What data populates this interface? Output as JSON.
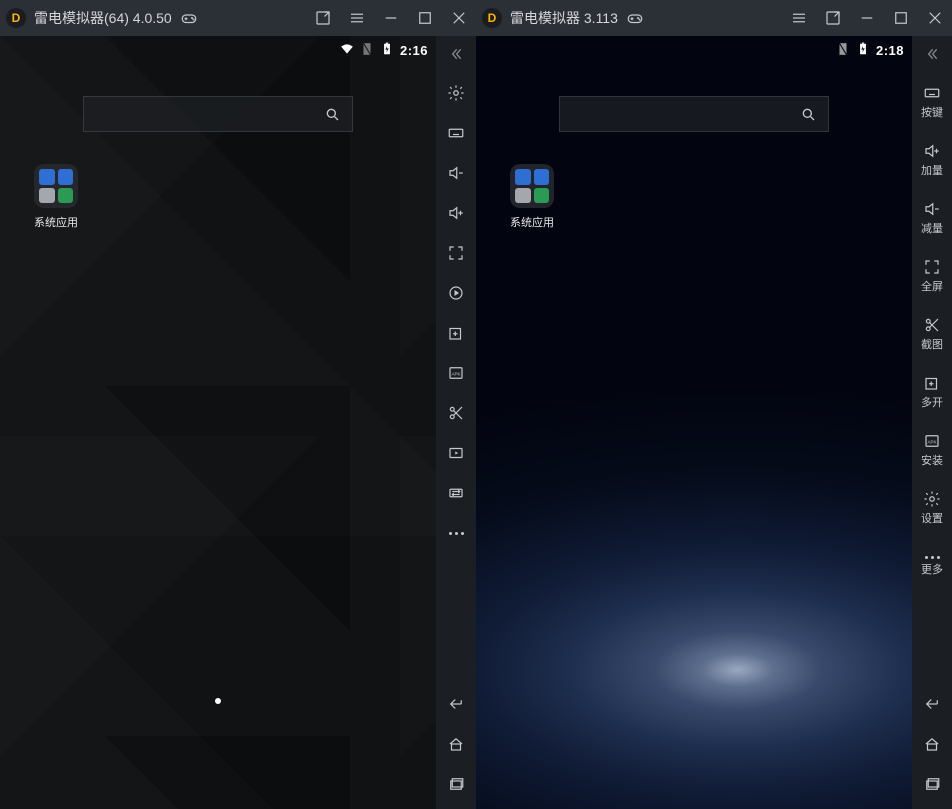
{
  "left": {
    "title": "雷电模拟器(64) 4.0.50",
    "statusbar": {
      "time": "2:16"
    },
    "folder_label": "系统应用"
  },
  "right": {
    "title": "雷电模拟器 3.113",
    "statusbar": {
      "time": "2:18"
    },
    "folder_label": "系统应用",
    "sidebar_labels": {
      "keymap": "按键",
      "vol_up": "加量",
      "vol_down": "减量",
      "fullscreen": "全屏",
      "screenshot": "截图",
      "multi": "多开",
      "install": "安装",
      "settings": "设置",
      "more": "更多"
    }
  },
  "icons": {
    "logo": "D"
  }
}
